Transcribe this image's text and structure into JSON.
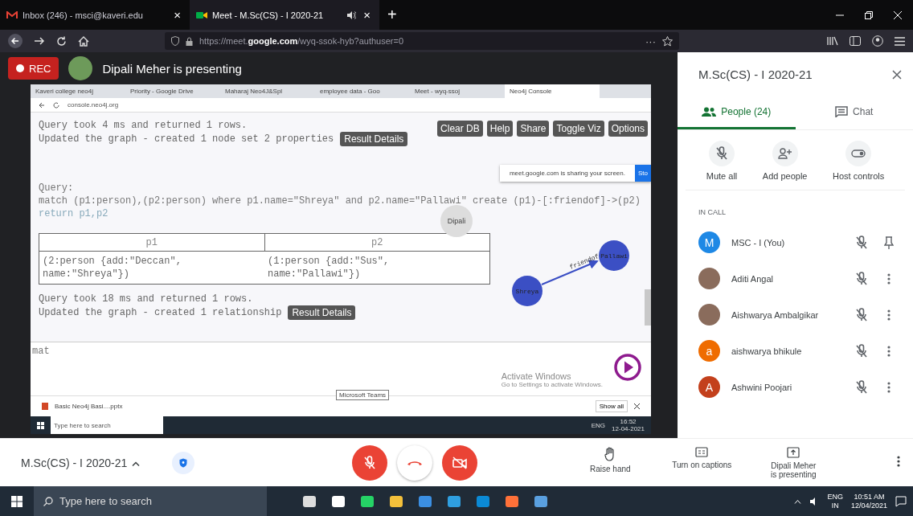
{
  "browser": {
    "tabs": [
      {
        "title": "Inbox (246) - msci@kaveri.edu",
        "selected": false,
        "audio": false,
        "close": "×"
      },
      {
        "title": "Meet - M.Sc(CS) - I 2020-21",
        "selected": true,
        "audio": true,
        "close": "×"
      }
    ],
    "new_tab": "+",
    "url": "https://meet.**google.com**/wyq-ssok-hyb?authuser=0",
    "page_actions": "···"
  },
  "meeting": {
    "rec_label": "REC",
    "presenter_text": "Dipali Meher is presenting"
  },
  "shared_screen": {
    "tabs": [
      {
        "title": "Kaveri college neo4j",
        "selected": false
      },
      {
        "title": "Priority - Google Drive",
        "selected": false
      },
      {
        "title": "Maharaj Neo4J&Spl",
        "selected": false
      },
      {
        "title": "employee data - Goo",
        "selected": false
      },
      {
        "title": "Meet - wyq-ssoj",
        "selected": false
      },
      {
        "title": "Neo4j Console",
        "selected": true
      }
    ],
    "url": "console.neo4j.org",
    "toolbar": [
      "Clear DB",
      "Help",
      "Share",
      "Toggle Viz",
      "Options"
    ],
    "share_notice": {
      "text": "meet.google.com is sharing your screen.",
      "button": "Sto"
    },
    "results": [
      {
        "kind": "status",
        "lines": [
          "Query took 4 ms and returned 1 rows.",
          "Updated the graph - created 1 node set 2 properties"
        ],
        "button": "Result Details"
      },
      {
        "kind": "query",
        "label": "Query:",
        "lines": [
          "match (p1:person),(p2:person) where p1.name=\"Shreya\" and p2.name=\"Pallawi\" create (p1)-[:friendof]->(p2)",
          "return p1,p2"
        ]
      },
      {
        "kind": "table",
        "columns": [
          "p1",
          "p2"
        ],
        "rows": [
          [
            "(2:person {add:\"Deccan\",\nname:\"Shreya\"})",
            "(1:person {add:\"Sus\",\nname:\"Pallawi\"})"
          ]
        ]
      },
      {
        "kind": "status",
        "lines": [
          "Query took 18 ms and returned 1 rows.",
          "Updated the graph - created 1 relationship"
        ],
        "button": "Result Details"
      }
    ],
    "graph": {
      "nodes": [
        {
          "label": "Shreya"
        },
        {
          "label": "Pallawi"
        }
      ],
      "edge": "friendof",
      "viewer": "Dipali"
    },
    "input": {
      "value": "mat"
    },
    "watermark": {
      "title": "Activate Windows",
      "subtitle": "Go to Settings to activate Windows."
    },
    "download": {
      "file": "Basic Neo4j Basi....pptx",
      "show_all": "Show all"
    },
    "tooltip": "Microsoft Teams",
    "taskbar": {
      "search": "Type here to search",
      "lang": "ENG",
      "time": "16:52",
      "date": "12-04-2021"
    }
  },
  "side_panel": {
    "title": "M.Sc(CS) - I 2020-21",
    "tabs": [
      {
        "label": "People (24)",
        "selected": true
      },
      {
        "label": "Chat",
        "selected": false
      }
    ],
    "actions": [
      "Mute all",
      "Add people",
      "Host controls"
    ],
    "section": "IN CALL",
    "participants": [
      {
        "name": "MSC - I (You)",
        "avatar": {
          "kind": "letter",
          "letter": "M",
          "color": "#1e88e5"
        },
        "muted": true,
        "kind": "self"
      },
      {
        "name": "Aditi Angal",
        "avatar": {
          "kind": "photo"
        },
        "muted": true,
        "kind": "other"
      },
      {
        "name": "Aishwarya Ambalgikar",
        "avatar": {
          "kind": "photo"
        },
        "muted": true,
        "kind": "other"
      },
      {
        "name": "aishwarya bhikule",
        "avatar": {
          "kind": "letter",
          "letter": "a",
          "color": "#ef6c00"
        },
        "muted": true,
        "kind": "other"
      },
      {
        "name": "Ashwini Poojari",
        "avatar": {
          "kind": "letter",
          "letter": "A",
          "color": "#c3401c"
        },
        "muted": true,
        "kind": "other"
      }
    ]
  },
  "bottom_bar": {
    "meeting_name": "M.Sc(CS) - I 2020-21",
    "mic_on": false,
    "camera_on": false,
    "actions": [
      "Raise hand",
      "Turn on captions",
      "Dipali Meher\nis presenting"
    ]
  },
  "taskbar": {
    "search": "Type here to search",
    "lang": "ENG",
    "region": "IN",
    "time": "10:51 AM",
    "date": "12/04/2021"
  }
}
